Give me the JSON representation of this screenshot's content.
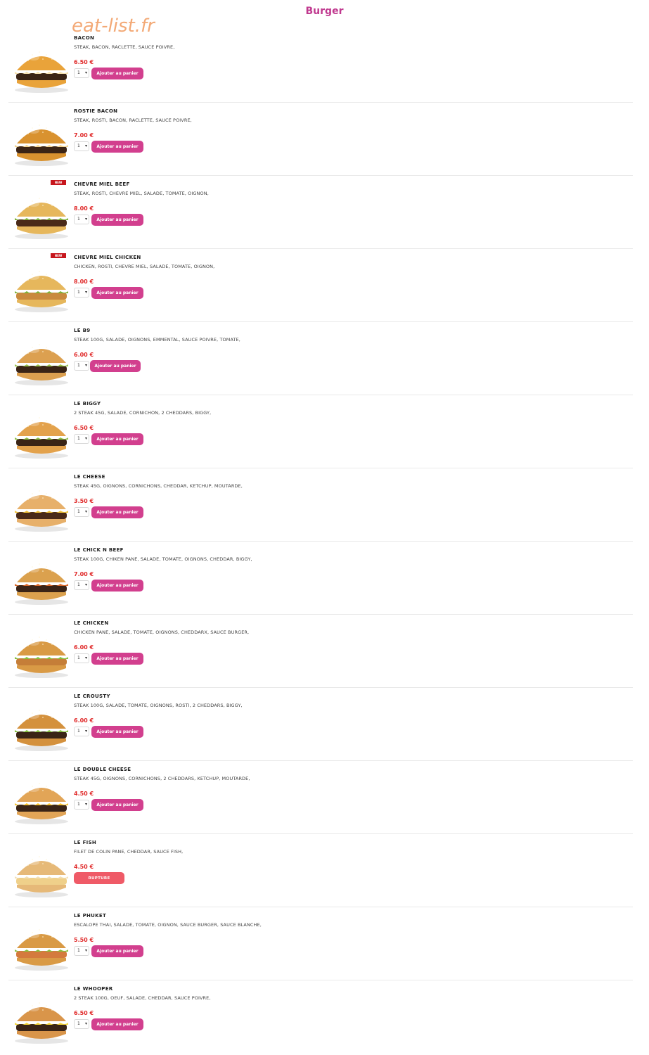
{
  "page": {
    "title": "Burger",
    "watermark": "eat-list.fr"
  },
  "labels": {
    "add_to_cart": "Ajouter au panier",
    "out_of_stock": "RUPTURE",
    "new_badge": "NEW"
  },
  "items": [
    {
      "name": "BACON",
      "desc": "STEAK, BACON, RACLETTE, SAUCE POIVRE,",
      "price": "6.50 €",
      "qty": "1",
      "new": false,
      "available": true
    },
    {
      "name": "ROSTIE BACON",
      "desc": "STEAK, ROSTI, BACON, RACLETTE, SAUCE POIVRE,",
      "price": "7.00 €",
      "qty": "1",
      "new": false,
      "available": true
    },
    {
      "name": "CHEVRE MIEL BEEF",
      "desc": "STEAK, ROSTI, CHEVRE MIEL, SALADE, TOMATE, OIGNON,",
      "price": "8.00 €",
      "qty": "1",
      "new": true,
      "available": true
    },
    {
      "name": "CHEVRE MIEL CHICKEN",
      "desc": "CHICKEN, ROSTI, CHEVRE MIEL, SALADE, TOMATE, OIGNON,",
      "price": "8.00 €",
      "qty": "1",
      "new": true,
      "available": true
    },
    {
      "name": "LE B9",
      "desc": "STEAK 100G, SALADE, OIGNONS, EMMENTAL, SAUCE POIVRE, TOMATE,",
      "price": "6.00 €",
      "qty": "1",
      "new": false,
      "available": true
    },
    {
      "name": "LE BIGGY",
      "desc": "2 STEAK 45G, SALADE, CORNICHON, 2 CHEDDARS, BIGGY,",
      "price": "6.50 €",
      "qty": "1",
      "new": false,
      "available": true
    },
    {
      "name": "LE CHEESE",
      "desc": "STEAK 45G, OIGNONS, CORNICHONS, CHEDDAR, KETCHUP, MOUTARDE,",
      "price": "3.50 €",
      "qty": "1",
      "new": false,
      "available": true
    },
    {
      "name": "LE CHICK N BEEF",
      "desc": "STEAK 100G, CHIKEN PANE, SALADE, TOMATE, OIGNONS, CHEDDAR, BIGGY,",
      "price": "7.00 €",
      "qty": "1",
      "new": false,
      "available": true
    },
    {
      "name": "LE CHICKEN",
      "desc": "CHICKEN PANE, SALADE, TOMATE, OIGNONS, CHEDDARX, SAUCE BURGER,",
      "price": "6.00 €",
      "qty": "1",
      "new": false,
      "available": true
    },
    {
      "name": "LE CROUSTY",
      "desc": "STEAK 100G, SALADE, TOMATE, OIGNONS, ROSTI, 2 CHEDDARS, BIGGY,",
      "price": "6.00 €",
      "qty": "1",
      "new": false,
      "available": true
    },
    {
      "name": "LE DOUBLE CHEESE",
      "desc": "STEAK 45G, OIGNONS, CORNICHONS, 2 CHEDDARS, KETCHUP, MOUTARDE,",
      "price": "4.50 €",
      "qty": "1",
      "new": false,
      "available": true
    },
    {
      "name": "LE FISH",
      "desc": "FILET DE COLIN PANE, CHEDDAR, SAUCE FISH,",
      "price": "4.50 €",
      "qty": "1",
      "new": false,
      "available": false
    },
    {
      "name": "LE PHUKET",
      "desc": "ESCALOPE THAI, SALADE, TOMATE, OIGNON, SAUCE BURGER, SAUCE BLANCHE,",
      "price": "5.50 €",
      "qty": "1",
      "new": false,
      "available": true
    },
    {
      "name": "LE WHOOPER",
      "desc": "2 STEAK 100G, OEUF, SALADE, CHEDDAR, SAUCE POIVRE,",
      "price": "6.50 €",
      "qty": "1",
      "new": false,
      "available": true
    }
  ]
}
